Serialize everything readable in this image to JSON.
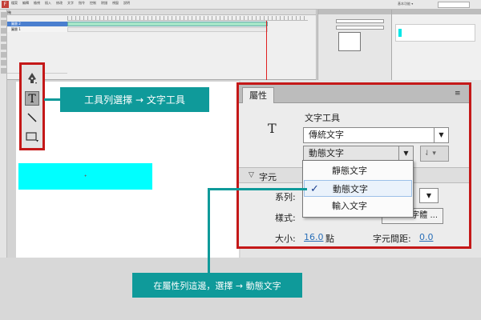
{
  "app": {
    "icon_letter": "F"
  },
  "menubar": {
    "items": [
      "檔案",
      "編輯",
      "檢視",
      "插入",
      "修改",
      "文字",
      "指令",
      "控制",
      "除錯",
      "視窗",
      "說明"
    ],
    "workspace": "基本功能 ▾"
  },
  "timeline": {
    "panel_title": "時間軸",
    "layers": [
      "圖層 2",
      "圖層 1"
    ]
  },
  "callout_tool": {
    "label": "工具列選擇 → 文字工具"
  },
  "callout_property": {
    "label": "在屬性列這邊，選擇 → 動態文字"
  },
  "properties_panel": {
    "tab": "屬性",
    "menu_icon": "panel-menu-icon",
    "tool_icon_glyph": "T",
    "tool_name": "文字工具",
    "text_engine": "傳統文字",
    "text_type": "動態文字",
    "align_button": "⇃ ▾",
    "section_title": "字元",
    "family_label": "系列:",
    "style_label": "樣式:",
    "embed_button": "字體 ...",
    "size_label": "大小:",
    "size_value": "16.0",
    "size_unit": "點",
    "spacing_label": "字元間距:",
    "spacing_value": "0.0"
  },
  "text_type_menu": {
    "options": [
      "靜態文字",
      "動態文字",
      "輸入文字"
    ],
    "selected": "動態文字",
    "check_glyph": "✓"
  },
  "colors": {
    "callout_border": "#c41818",
    "label_bg": "#0f9a9a",
    "cyan_textbox": "#00ffff"
  }
}
